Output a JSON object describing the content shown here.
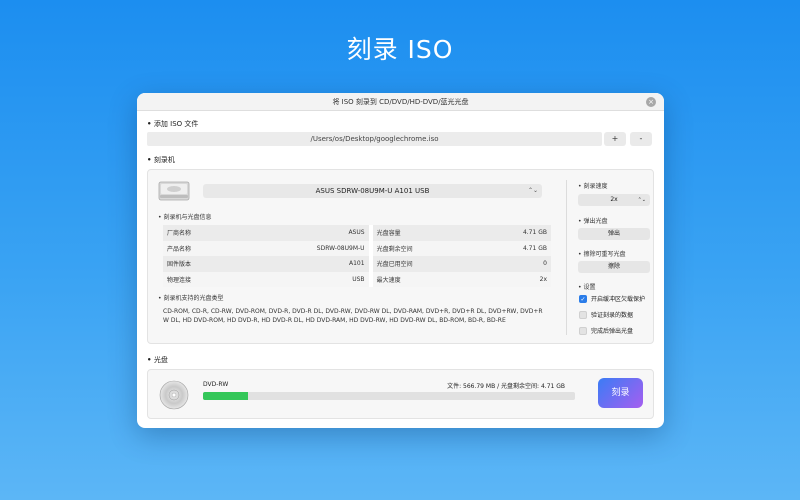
{
  "hero_title": "刻录 ISO",
  "window": {
    "title": "将 ISO 刻录到 CD/DVD/HD-DVD/蓝光光盘",
    "close_symbol": "×"
  },
  "add_iso": {
    "label": "添加 ISO 文件",
    "path": "/Users/os/Desktop/googlechrome.iso",
    "add_button": "+",
    "remove_button": "-"
  },
  "burner": {
    "label": "刻录机",
    "selected_drive": "ASUS SDRW-08U9M-U A101 USB",
    "select_arrows": "⌃⌄",
    "info_label": "刻录机与光盘信息",
    "info_rows": [
      {
        "k1": "厂商名称",
        "v1": "ASUS",
        "k2": "光盘容量",
        "v2": "4.71 GB"
      },
      {
        "k1": "产品名称",
        "v1": "SDRW-08U9M-U",
        "k2": "光盘剩余空间",
        "v2": "4.71 GB"
      },
      {
        "k1": "固件版本",
        "v1": "A101",
        "k2": "光盘已用空间",
        "v2": "0"
      },
      {
        "k1": "物理连接",
        "v1": "USB",
        "k2": "最大速度",
        "v2": "2x"
      }
    ],
    "media_label": "刻录机支持的光盘类型",
    "media_types": "CD-ROM, CD-R, CD-RW, DVD-ROM, DVD-R, DVD-R DL, DVD-RW, DVD-RW DL, DVD-RAM, DVD+R, DVD+R DL, DVD+RW, DVD+RW DL, HD DVD-ROM, HD DVD-R, HD DVD-R DL, HD DVD-RAM, HD DVD-RW, HD DVD-RW DL, BD-ROM, BD-R, BD-RE"
  },
  "right": {
    "speed_label": "刻录速度",
    "speed_value": "2x",
    "eject_label": "弹出光盘",
    "eject_button": "弹出",
    "erase_label": "擦除可重写光盘",
    "erase_button": "擦除",
    "settings_label": "设置",
    "options": [
      {
        "label": "开启缓冲区欠载保护",
        "checked": true
      },
      {
        "label": "验证刻录的数据",
        "checked": false
      },
      {
        "label": "完成后弹出光盘",
        "checked": false
      }
    ]
  },
  "disc": {
    "label": "光盘",
    "type": "DVD-RW",
    "info": "文件: 566.79 MB / 光盘剩余空间: 4.71 GB",
    "progress_fraction": 0.12,
    "burn_button": "刻录"
  },
  "colors": {
    "accent": "#2b7de9",
    "progress": "#34c759",
    "burn_gradient_start": "#3b7cf5",
    "burn_gradient_end": "#a65ef0"
  },
  "icons": {
    "drive": "optical-drive-icon",
    "disc": "disc-icon"
  }
}
